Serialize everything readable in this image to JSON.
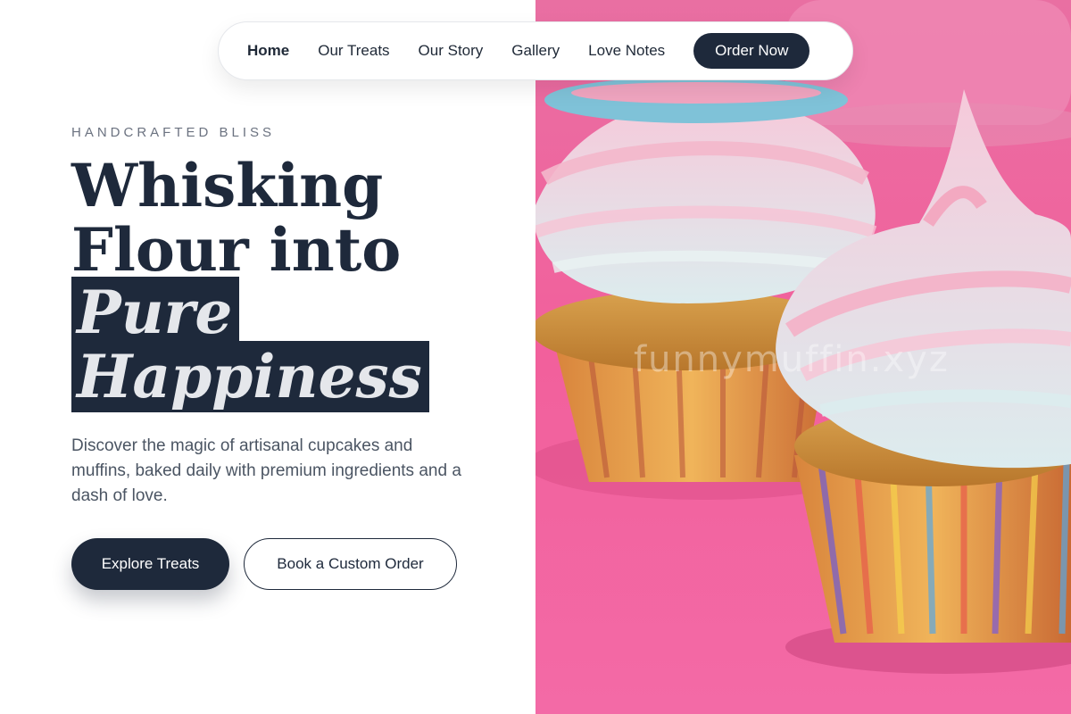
{
  "nav": {
    "items": [
      {
        "label": "Home",
        "active": true
      },
      {
        "label": "Our Treats",
        "active": false
      },
      {
        "label": "Our Story",
        "active": false
      },
      {
        "label": "Gallery",
        "active": false
      },
      {
        "label": "Love Notes",
        "active": false
      }
    ],
    "cta_label": "Order Now"
  },
  "hero": {
    "eyebrow": "HANDCRAFTED BLISS",
    "headline_line1": "Whisking",
    "headline_line2": "Flour into",
    "headline_highlight1": "Pure",
    "headline_highlight2": "Happiness",
    "description": "Discover the magic of artisanal cupcakes and muffins, baked daily with premium ingredients and a dash of love.",
    "primary_button": "Explore Treats",
    "secondary_button": "Book a Custom Order"
  },
  "image": {
    "watermark": "funnymuffin.xyz",
    "subject": "two-swirl-frosted-cupcakes"
  },
  "colors": {
    "primary": "#1e293b",
    "background": "#ffffff",
    "photo_pink": "#f4659f",
    "muted_text": "#4b5563"
  }
}
